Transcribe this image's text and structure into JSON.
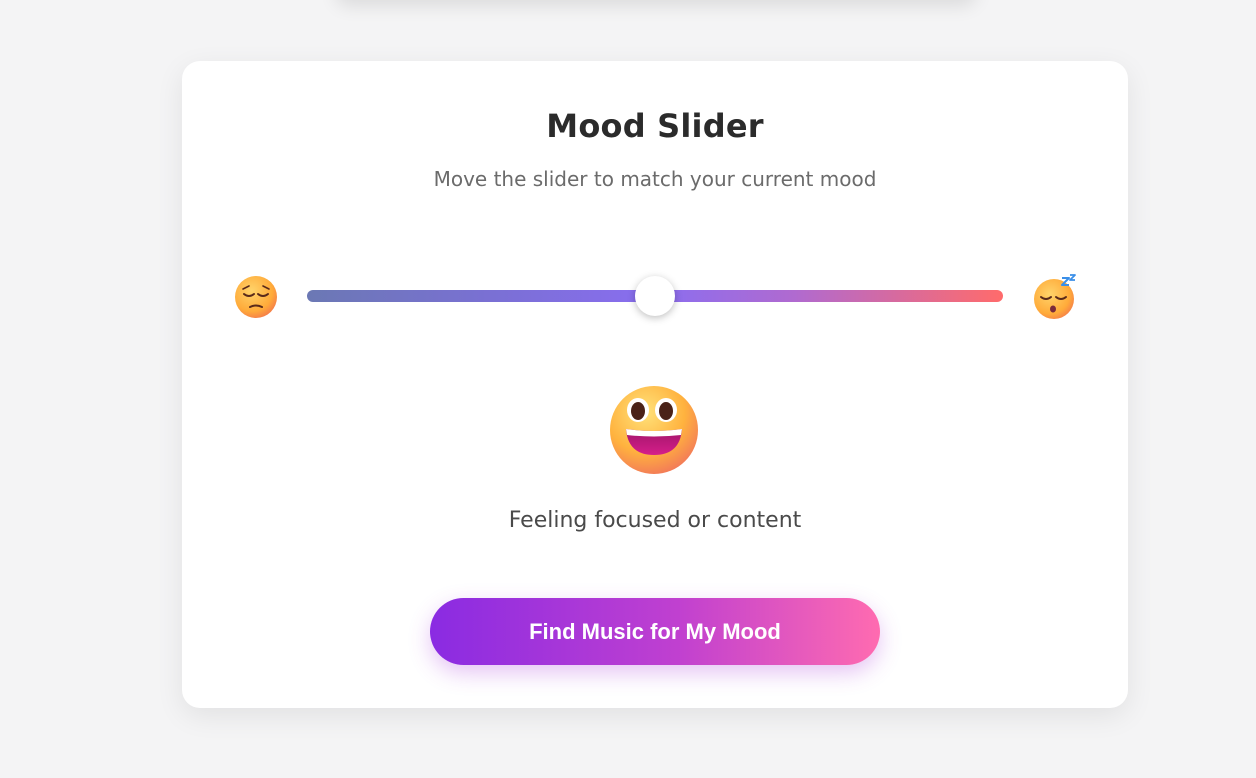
{
  "card": {
    "title": "Mood Slider",
    "subtitle": "Move the slider to match your current mood"
  },
  "slider": {
    "min_icon": "pensive-face-icon",
    "max_icon": "sleeping-face-icon",
    "value_fraction": 0.5,
    "gradient_colors": [
      "#6b78b4",
      "#8a6ef0",
      "#ff6b6b"
    ]
  },
  "mood": {
    "icon": "grinning-face-icon",
    "text": "Feeling focused or content"
  },
  "cta": {
    "label": "Find Music for My Mood",
    "gradient_colors": [
      "#8a2be2",
      "#ff6bb0"
    ]
  }
}
